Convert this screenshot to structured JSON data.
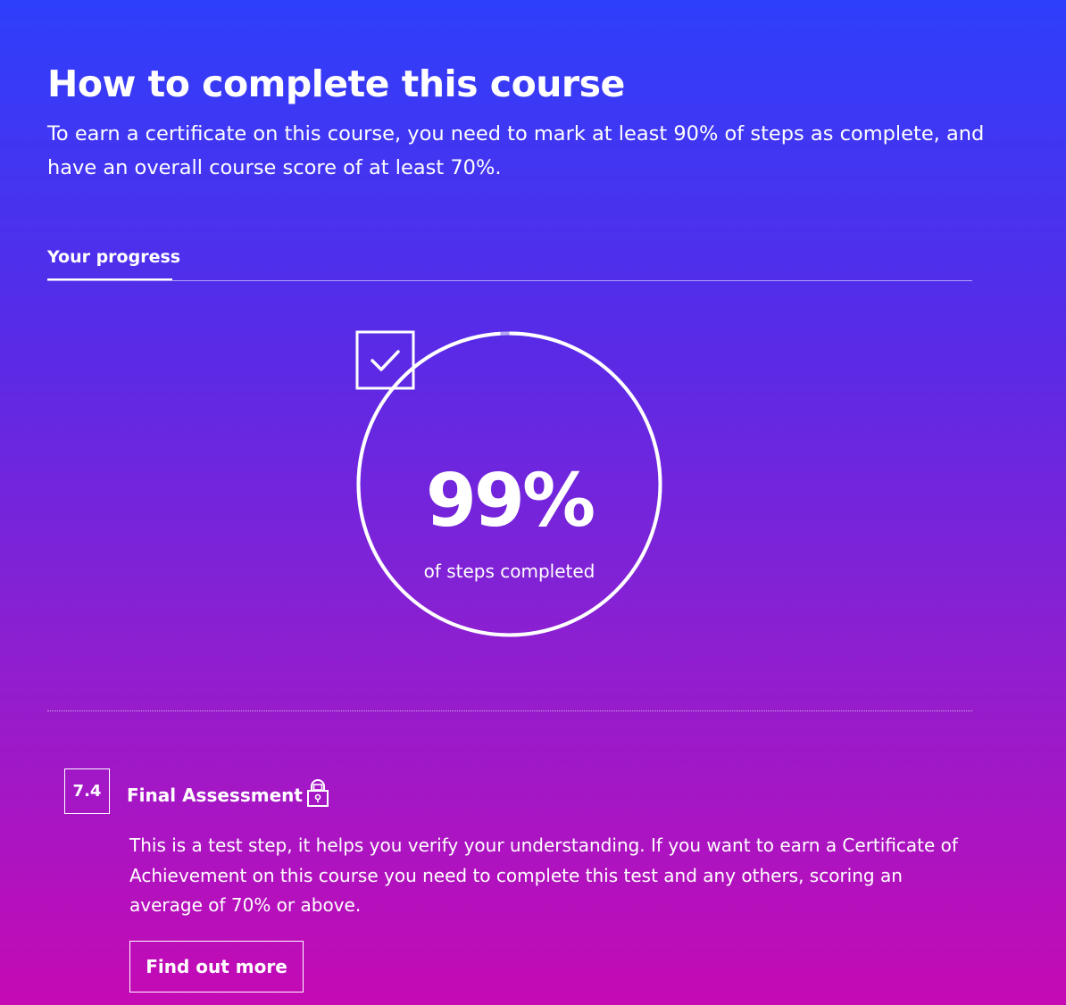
{
  "page": {
    "title": "How to complete this course",
    "intro": "To earn a certificate on this course, you need to mark at least 90% of steps as complete, and have an overall course score of at least 70%."
  },
  "tabs": [
    {
      "label": "Your progress",
      "active": true
    }
  ],
  "progress": {
    "percent_text": "99%",
    "percent_value": 99,
    "caption": "of steps completed",
    "icon": "checkbox-icon"
  },
  "step": {
    "number": "7.4",
    "title": "Final Assessment",
    "icon": "lock-icon",
    "description": "This is a test step, it helps you verify your understanding. If you want to earn a Certificate of Achievement on this course you need to complete this test and any others, scoring an average of 70% or above.",
    "button_label": "Find out more"
  },
  "colors": {
    "gradient_top": "#2e3ffb",
    "gradient_bottom": "#c50ab4",
    "text": "#ffffff"
  }
}
